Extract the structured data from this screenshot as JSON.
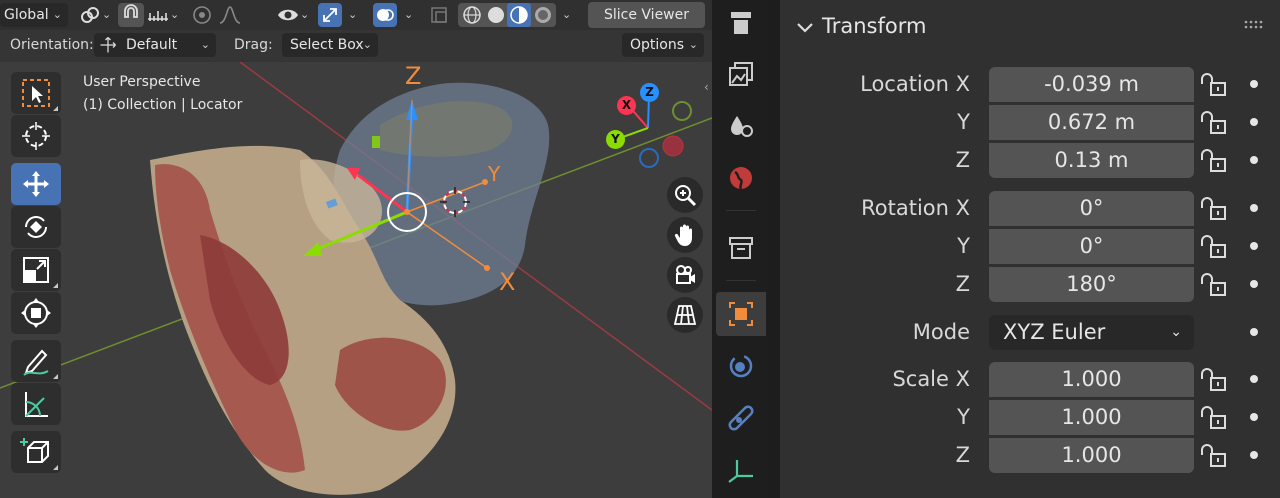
{
  "header": {
    "transform_orientation": "Global",
    "slice_viewer_label": "Slice Viewer"
  },
  "subheader": {
    "orientation_label": "Orientation:",
    "orientation_value": "Default",
    "drag_label": "Drag:",
    "drag_value": "Select Box",
    "options_label": "Options"
  },
  "overlay": {
    "perspective": "User Perspective",
    "collection": "(1) Collection | Locator"
  },
  "gizmo": {
    "x": "X",
    "y": "Y",
    "z": "Z"
  },
  "transform_panel": {
    "title": "Transform",
    "location": {
      "label_x": "Location X",
      "label_y": "Y",
      "label_z": "Z",
      "x": "-0.039 m",
      "y": "0.672 m",
      "z": "0.13 m"
    },
    "rotation": {
      "label_x": "Rotation X",
      "label_y": "Y",
      "label_z": "Z",
      "x": "0°",
      "y": "0°",
      "z": "180°"
    },
    "mode": {
      "label": "Mode",
      "value": "XYZ Euler"
    },
    "scale": {
      "label_x": "Scale X",
      "label_y": "Y",
      "label_z": "Z",
      "x": "1.000",
      "y": "1.000",
      "z": "1.000"
    }
  },
  "colors": {
    "accent": "#4772b3",
    "x_axis": "#ff3352",
    "y_axis": "#8bdc00",
    "z_axis": "#2890ff",
    "object_tab": "#f08c3c"
  }
}
